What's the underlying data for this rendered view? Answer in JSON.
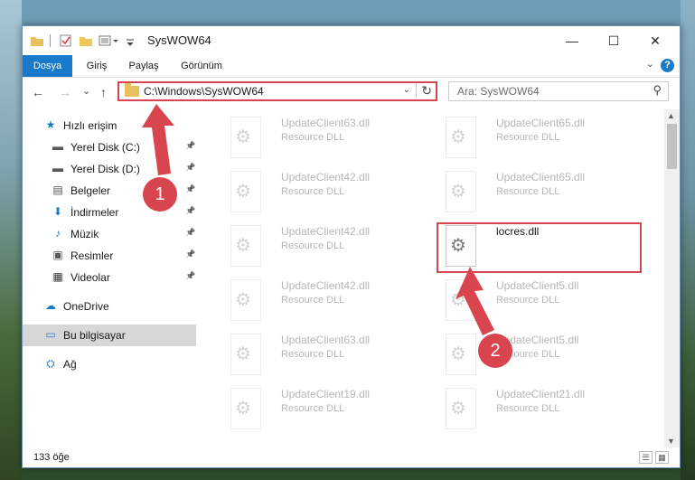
{
  "window": {
    "title": "SysWOW64",
    "controls": {
      "minimize": "—",
      "maximize": "☐",
      "close": "✕"
    }
  },
  "ribbon": {
    "tabs": [
      "Dosya",
      "Giriş",
      "Paylaş",
      "Görünüm"
    ],
    "help": "?"
  },
  "nav": {
    "back": "←",
    "forward": "→",
    "recent": "⌄",
    "up": "↑",
    "address": "C:\\Windows\\SysWOW64",
    "search_placeholder": "Ara: SysWOW64"
  },
  "sidebar": {
    "items": [
      {
        "label": "Hızlı erişim",
        "icon": "star-icon",
        "pinned": false
      },
      {
        "label": "Yerel Disk (C:)",
        "icon": "drive-icon",
        "pinned": true
      },
      {
        "label": "Yerel Disk (D:)",
        "icon": "drive-icon",
        "pinned": true
      },
      {
        "label": "Belgeler",
        "icon": "document-icon",
        "pinned": true
      },
      {
        "label": "İndirmeler",
        "icon": "download-icon",
        "pinned": true
      },
      {
        "label": "Müzik",
        "icon": "music-icon",
        "pinned": true
      },
      {
        "label": "Resimler",
        "icon": "pictures-icon",
        "pinned": true
      },
      {
        "label": "Videolar",
        "icon": "video-icon",
        "pinned": true
      },
      {
        "label": "OneDrive",
        "icon": "cloud-icon",
        "pinned": false
      },
      {
        "label": "Bu bilgisayar",
        "icon": "computer-icon",
        "pinned": false,
        "selected": true
      },
      {
        "label": "Ağ",
        "icon": "network-icon",
        "pinned": false
      }
    ]
  },
  "files": [
    {
      "name": "UpdateClient63.dll",
      "desc": "Resource DLL"
    },
    {
      "name": "UpdateClient65.dll",
      "desc": "Resource DLL"
    },
    {
      "name": "UpdateClient42.dll",
      "desc": "Resource DLL"
    },
    {
      "name": "UpdateClient65.dll",
      "desc": "Resource DLL"
    },
    {
      "name": "UpdateClient42.dll",
      "desc": "Resource DLL"
    },
    {
      "name": "locres.dll",
      "desc": ""
    },
    {
      "name": "UpdateClient42.dll",
      "desc": "Resource DLL"
    },
    {
      "name": "UpdateClient5.dll",
      "desc": "Resource DLL"
    },
    {
      "name": "UpdateClient63.dll",
      "desc": "Resource DLL"
    },
    {
      "name": "UpdateClient5.dll",
      "desc": "Resource DLL"
    },
    {
      "name": "UpdateClient19.dll",
      "desc": "Resource DLL"
    },
    {
      "name": "UpdateClient21.dll",
      "desc": "Resource DLL"
    }
  ],
  "status": {
    "count": "133 öğe"
  },
  "annotations": {
    "step1": "1",
    "step2": "2"
  },
  "colors": {
    "accent": "#1979ca",
    "highlight": "#d9454e"
  }
}
